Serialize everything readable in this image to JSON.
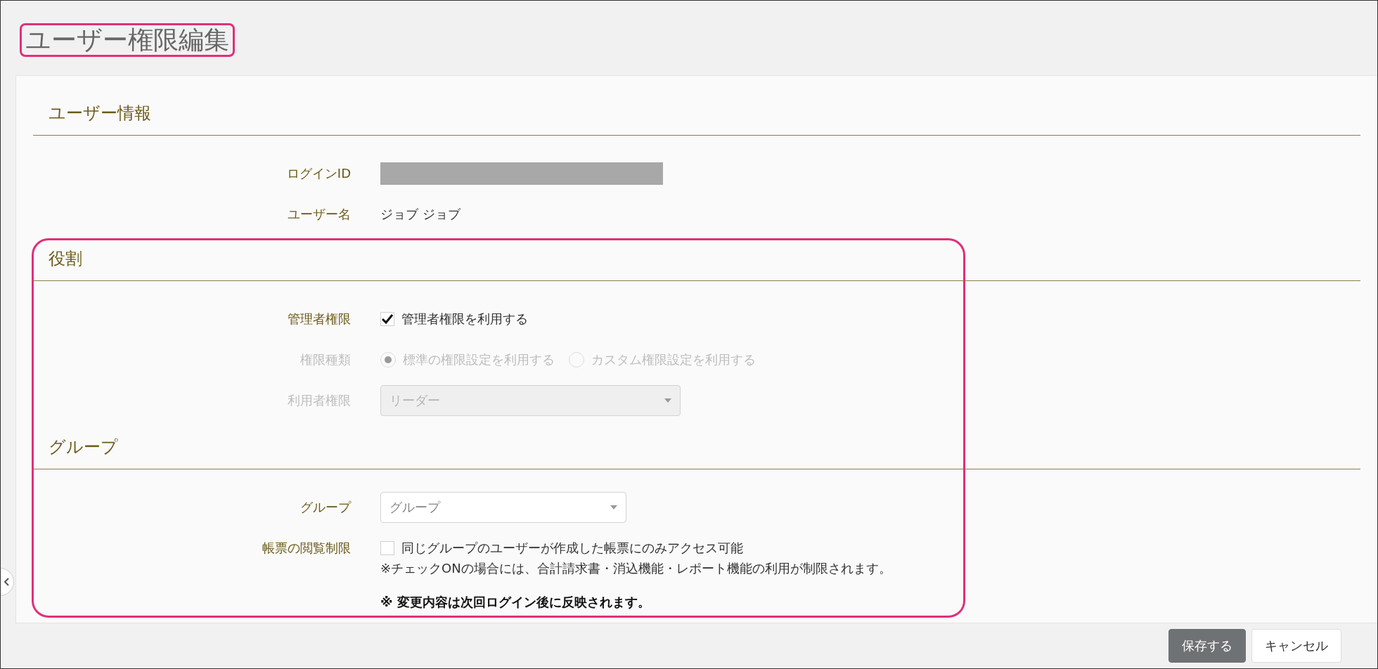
{
  "page": {
    "title": "ユーザー権限編集",
    "title_highlighted": true
  },
  "sections": [
    {
      "heading": "ユーザー情報",
      "highlighted": false,
      "rows": [
        {
          "kind": "masked",
          "label": "ログインID"
        },
        {
          "kind": "text",
          "label": "ユーザー名",
          "value": "ジョブ ジョブ"
        }
      ]
    },
    {
      "heading": "役割",
      "highlighted": true,
      "rows": [
        {
          "kind": "checkbox",
          "label": "管理者権限",
          "disabled": false,
          "option": {
            "label": "管理者権限を利用する",
            "checked": true
          }
        },
        {
          "kind": "radio",
          "label": "権限種類",
          "disabled": true,
          "options": [
            {
              "label": "標準の権限設定を利用する",
              "selected": true
            },
            {
              "label": "カスタム権限設定を利用する",
              "selected": false
            }
          ]
        },
        {
          "kind": "select",
          "label": "利用者権限",
          "disabled": true,
          "value": "リーダー"
        }
      ]
    },
    {
      "heading": "グループ",
      "highlighted": true,
      "rows": [
        {
          "kind": "select",
          "label": "グループ",
          "disabled": false,
          "placeholder": "グループ"
        },
        {
          "kind": "checkbox",
          "label": "帳票の閲覧制限",
          "disabled": false,
          "option": {
            "label": "同じグループのユーザーが作成した帳票にのみアクセス可能",
            "checked": false
          },
          "note": "※チェックONの場合には、合計請求書・消込機能・レポート機能の利用が制限されます。"
        }
      ],
      "footnote": "※ 変更内容は次回ログイン後に反映されます。"
    }
  ],
  "buttons": [
    {
      "label": "保存する",
      "kind": "primary"
    },
    {
      "label": "キャンセル",
      "kind": "secondary"
    }
  ]
}
